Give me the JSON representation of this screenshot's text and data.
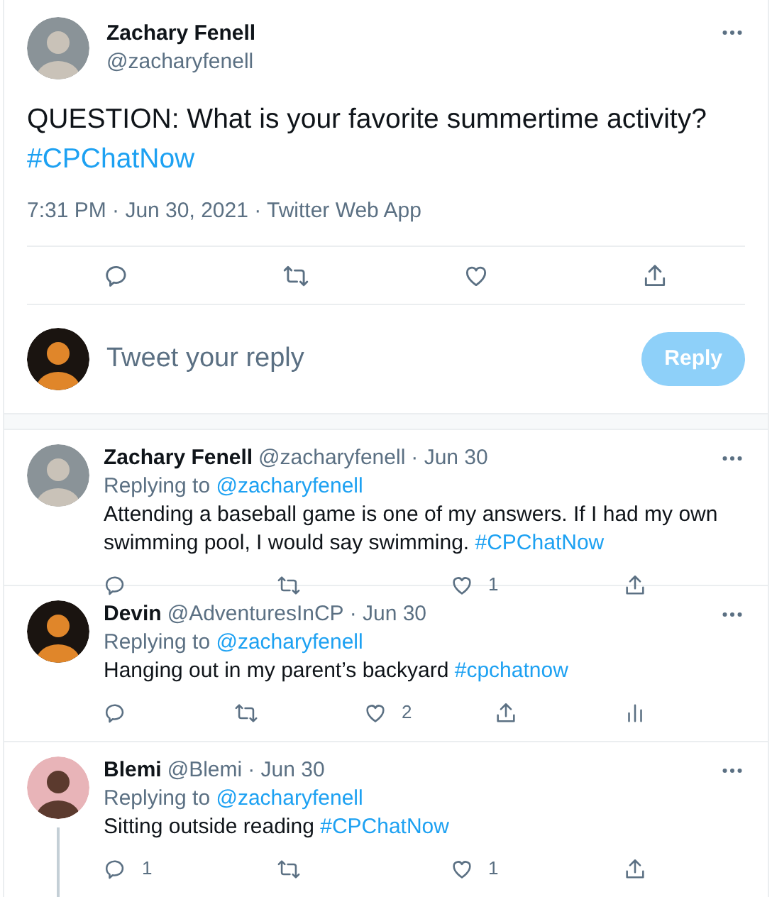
{
  "tweet": {
    "name": "Zachary Fenell",
    "handle": "@zacharyfenell",
    "text": "QUESTION: What is your favorite summertime activity?",
    "hashtag": "#CPChatNow",
    "timestamp": "7:31 PM · Jun 30, 2021 · Twitter Web App",
    "actions": [
      {
        "kind": "reply"
      },
      {
        "kind": "retweet"
      },
      {
        "kind": "like"
      },
      {
        "kind": "share"
      }
    ]
  },
  "composer": {
    "placeholder": "Tweet your reply",
    "button": {
      "label": "Reply",
      "disabled": true
    }
  },
  "replies": [
    {
      "name": "Zachary Fenell",
      "handle": "@zacharyfenell",
      "date": "· Jun 30",
      "replying_label": "Replying to",
      "replying_to": "@zacharyfenell",
      "text": "Attending a baseball game is one of my answers. If I had my own swimming pool, I would say swimming.",
      "hashtag": "#CPChatNow",
      "thread_continues": false,
      "actions": [
        {
          "kind": "reply"
        },
        {
          "kind": "retweet"
        },
        {
          "kind": "like",
          "count": "1"
        },
        {
          "kind": "share"
        }
      ]
    },
    {
      "name": "Devin",
      "handle": "@AdventuresInCP",
      "date": "· Jun 30",
      "replying_label": "Replying to",
      "replying_to": "@zacharyfenell",
      "text": "Hanging out in my parent’s backyard",
      "hashtag": "#cpchatnow",
      "thread_continues": false,
      "actions": [
        {
          "kind": "reply"
        },
        {
          "kind": "retweet"
        },
        {
          "kind": "like",
          "count": "2"
        },
        {
          "kind": "share"
        },
        {
          "kind": "analytics"
        }
      ]
    },
    {
      "name": "Blemi",
      "handle": "@Blemi",
      "date": "· Jun 30",
      "replying_label": "Replying to",
      "replying_to": "@zacharyfenell",
      "text": "Sitting outside reading",
      "hashtag": "#CPChatNow",
      "thread_continues": true,
      "actions": [
        {
          "kind": "reply",
          "count": "1"
        },
        {
          "kind": "retweet"
        },
        {
          "kind": "like",
          "count": "1"
        },
        {
          "kind": "share"
        }
      ]
    }
  ]
}
